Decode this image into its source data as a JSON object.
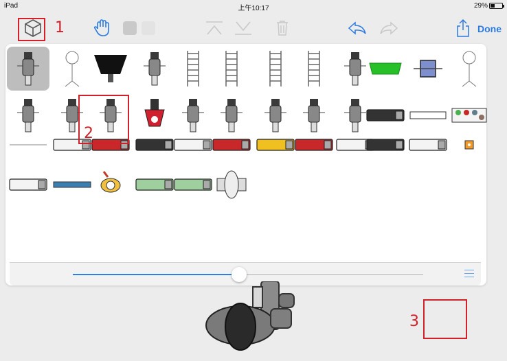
{
  "status_bar": {
    "device": "iPad",
    "time": "上午10:17",
    "battery": "29%"
  },
  "toolbar": {
    "done_label": "Done",
    "icons": [
      "cube-icon",
      "hand-icon",
      "color-swatch-gray",
      "color-swatch-light",
      "move-top-icon",
      "move-bottom-icon",
      "trash-icon",
      "undo-icon",
      "redo-icon",
      "share-icon"
    ]
  },
  "annotations": {
    "label_1": "1",
    "label_2": "2",
    "label_3": "3"
  },
  "palette": {
    "rows": [
      [
        "projector-unit",
        "satellite-dish",
        "softbox-light",
        "dolly-top",
        "ladder-track",
        "ladder-track-wide",
        "curved-track",
        "curved-track-2",
        "dolly-camera",
        "green-pad",
        "light-fixture",
        "stand-pole"
      ],
      [
        "camera-rig",
        "camera-rig-2",
        "camera-operator",
        "red-fresnel",
        "camera-body",
        "boom-arm",
        "flag-panel",
        "head-unit",
        "camera-3",
        "small-truck-black",
        "label-strip",
        "color-chart"
      ],
      [
        "cable-line",
        "trailer-white",
        "red-truck",
        "dark-trailer",
        "white-trailer",
        "red-box-truck",
        "yellow-bus",
        "red-semi",
        "car-white",
        "dark-semi",
        "restroom-trailer",
        "orange-marker"
      ],
      [
        "trailer-hitch",
        "blue-hose",
        "actor-topdown",
        "green-van",
        "green-car",
        "turntable"
      ]
    ],
    "selected_index": 0,
    "slider_value": 0.47
  },
  "colors": {
    "accent": "#2a7ae2",
    "annotation": "#d0202a"
  }
}
